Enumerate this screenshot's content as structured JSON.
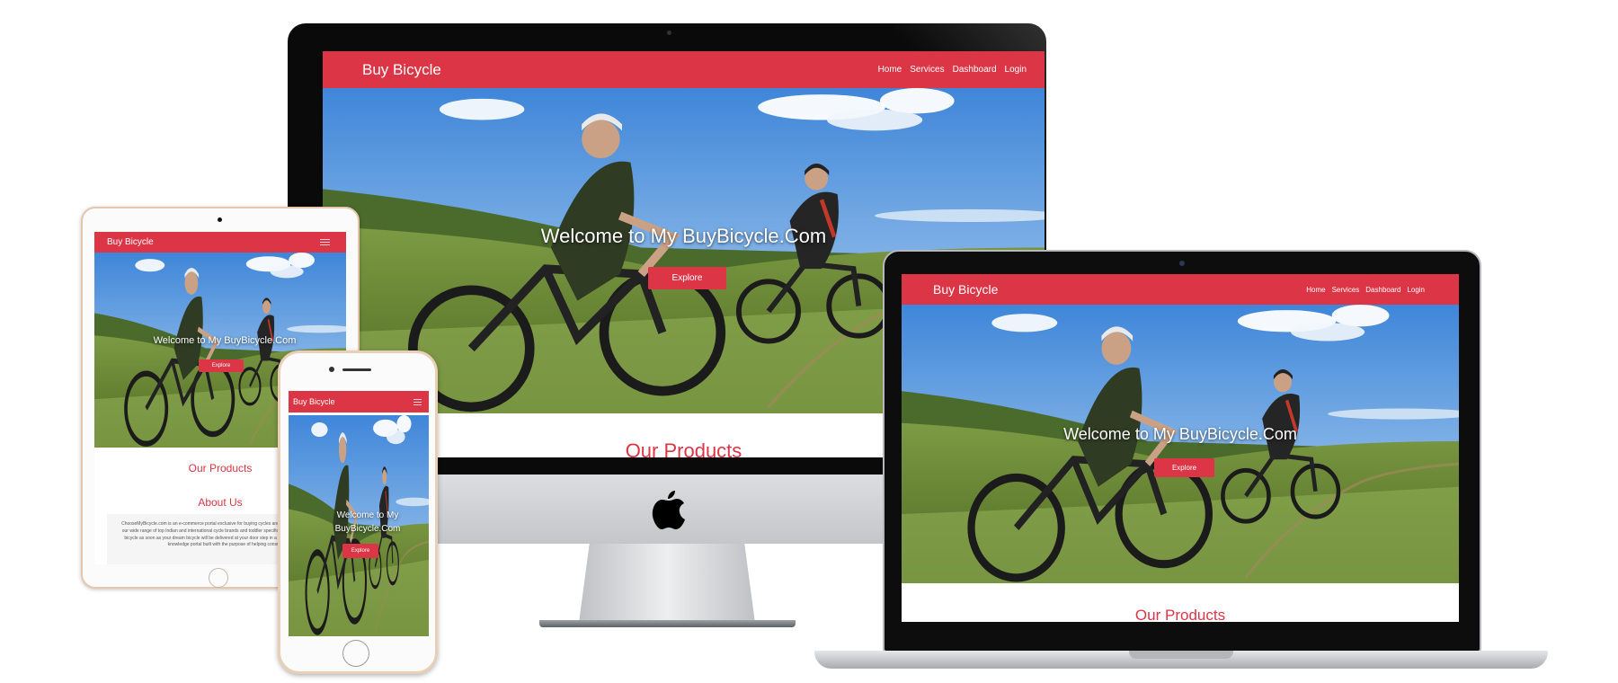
{
  "site": {
    "brand": "Buy Bicycle",
    "nav": [
      "Home",
      "Services",
      "Dashboard",
      "Login"
    ],
    "hero_title": "Welcome to My BuyBicycle.Com",
    "hero_title_line1": "Welcome to My",
    "hero_title_line2": "BuyBicycle.Com",
    "cta": "Explore",
    "products_heading": "Our Products",
    "about_heading": "About Us",
    "about_text": "ChooseMyBicycle.com is an e-commerce portal exclusive for buying cycles and apparels. One can pick from our wide range of top Indian and international cycle brands and toddler specific range of bicycles. Save your bicycle as soon as your dream bicycle will be delivered at your door step in a unique ready. Also an online knowledge portal built with the purpose of helping consumers."
  },
  "colors": {
    "accent": "#dc3545",
    "sky": "#4f8fd6",
    "grass": "#6f8f3a"
  },
  "icons": {
    "apple": "apple-logo-icon",
    "menu": "hamburger-menu-icon"
  }
}
